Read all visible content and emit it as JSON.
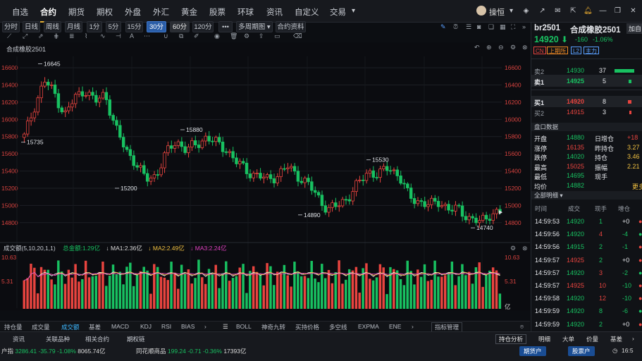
{
  "topnav": {
    "tabs": [
      "自选",
      "合约",
      "期货",
      "期权",
      "外盘",
      "外汇",
      "黄金",
      "股票",
      "环球",
      "资讯",
      "自定义",
      "交易"
    ],
    "active": "合约",
    "username": "操恒"
  },
  "toolbar": {
    "periods": [
      "分时",
      "日线",
      "周线",
      "月线",
      "1分",
      "5分",
      "15分",
      "30分",
      "60分",
      "120分"
    ],
    "active_period": "30分",
    "more": "•••",
    "multi_period": "多周期图",
    "contract_info": "合约资料"
  },
  "chart": {
    "title": "合成橡胶2501",
    "y_ticks": [
      "16600",
      "16400",
      "16200",
      "16000",
      "15800",
      "15600",
      "15400",
      "15200",
      "15000",
      "14800"
    ],
    "x_ticks": [
      "2024/09",
      "10/09",
      "10/11",
      "10/15",
      "10/17",
      "10/21",
      "10/23",
      "10/25",
      "10/29"
    ],
    "annotations": {
      "a1": "16645",
      "a2": "15735",
      "a3": "15880",
      "a4": "15200",
      "a5": "15530",
      "a6": "14890",
      "a7": "14740"
    }
  },
  "volume": {
    "title": "成交额(5,10,20,1,1)",
    "total": "总金额:1.29亿",
    "ma1": "MA1:2.36亿",
    "ma2": "MA2:2.49亿",
    "ma3": "MA3:2.24亿",
    "y_top": "10.63",
    "y_mid": "5.31",
    "unit": "亿"
  },
  "chart_data": {
    "type": "candlestick",
    "title": "合成橡胶2501",
    "period": "30分",
    "ylim": [
      14700,
      16650
    ],
    "x_labels": [
      "2024/09",
      "10/09",
      "10/11",
      "10/15",
      "10/17",
      "10/21",
      "10/23",
      "10/25",
      "10/29"
    ],
    "marked_extremes": [
      {
        "label": "high",
        "value": 16645
      },
      {
        "label": "low",
        "value": 15735
      },
      {
        "label": "high",
        "value": 15880
      },
      {
        "label": "low",
        "value": 15200
      },
      {
        "label": "high",
        "value": 15530
      },
      {
        "label": "low",
        "value": 14890
      },
      {
        "label": "low",
        "value": 14740
      }
    ],
    "close_path": [
      15800,
      16150,
      16450,
      16300,
      16050,
      16250,
      16350,
      16200,
      16300,
      15900,
      15650,
      15500,
      15300,
      15350,
      15600,
      15750,
      15650,
      15700,
      15800,
      15720,
      15650,
      15500,
      15400,
      15350,
      15300,
      15350,
      15450,
      15350,
      15250,
      15100,
      14950,
      15000,
      15100,
      15250,
      15400,
      15350,
      15450,
      15350,
      15100,
      15050,
      15000,
      15050,
      14950,
      14950,
      14850,
      14800,
      14900,
      14920
    ],
    "volume_ylim": [
      0,
      10.63
    ],
    "volume_unit": "亿"
  },
  "indicator_tabs_left": [
    "持仓量",
    "成交量",
    "成交额",
    "基差",
    "MACD",
    "KDJ",
    "RSI",
    "BIAS"
  ],
  "indicator_tabs_left_active": "成交额",
  "indicator_tabs_right": [
    "BOLL",
    "神奇九转",
    "买持价格",
    "多空线",
    "EXPMA",
    "ENE"
  ],
  "indicator_manage": "指标管理",
  "bottom_links": [
    "资讯",
    "关联品种",
    "相关合约",
    "期权链"
  ],
  "index_bar": {
    "i1_name": "户指",
    "i1_val": "3286.41",
    "i1_chg": "-35.79",
    "i1_pct": "-1.08%",
    "i1_amt": "8065.74亿",
    "i2_name": "同花顺商品",
    "i2_val": "199.24",
    "i2_chg": "-0.71",
    "i2_pct": "-0.36%",
    "i2_amt": "17393亿"
  },
  "holding_analysis": "持仓分析",
  "right": {
    "code": "br2501",
    "name": "合成橡胶2501",
    "add": "加自",
    "price": "14920",
    "change": "-160",
    "pct": "-1.06%",
    "tags": [
      "CN",
      "上期所",
      "L2",
      "主力"
    ],
    "ask2_label": "卖2",
    "ask2_price": "14930",
    "ask2_vol": "37",
    "ask1_label": "卖1",
    "ask1_price": "14925",
    "ask1_vol": "5",
    "bid1_label": "买1",
    "bid1_price": "14920",
    "bid1_vol": "8",
    "bid2_label": "买2",
    "bid2_price": "14915",
    "bid2_vol": "3",
    "section_title": "盘口数据",
    "stats": [
      {
        "l": "开盘",
        "v": "14880",
        "l2": "日增仓",
        "v2": "+18"
      },
      {
        "l": "涨停",
        "v": "16135",
        "l2": "昨持仓",
        "v2": "3.27"
      },
      {
        "l": "跌停",
        "v": "14020",
        "l2": "持仓",
        "v2": "3.46"
      },
      {
        "l": "最高",
        "v": "15025",
        "l2": "振幅",
        "v2": "2.21"
      },
      {
        "l": "最低",
        "v": "14695",
        "l2": "现手",
        "v2": ""
      },
      {
        "l": "均价",
        "v": "14882",
        "l2": "",
        "v2": "更多"
      }
    ],
    "ticks_title": "全部明细",
    "tick_headers": [
      "时间",
      "成交",
      "现手",
      "增仓"
    ],
    "ticks": [
      {
        "t": "14:59:53",
        "p": "14920",
        "v": "1",
        "d": "+0"
      },
      {
        "t": "14:59:56",
        "p": "14920",
        "v": "4",
        "d": "-4"
      },
      {
        "t": "14:59:56",
        "p": "14915",
        "v": "2",
        "d": "-1"
      },
      {
        "t": "14:59:57",
        "p": "14925",
        "v": "2",
        "d": "+0"
      },
      {
        "t": "14:59:57",
        "p": "14920",
        "v": "3",
        "d": "-2"
      },
      {
        "t": "14:59:57",
        "p": "14925",
        "v": "10",
        "d": "-10"
      },
      {
        "t": "14:59:58",
        "p": "14920",
        "v": "12",
        "d": "-10"
      },
      {
        "t": "14:59:59",
        "p": "14920",
        "v": "8",
        "d": "-6"
      },
      {
        "t": "14:59:59",
        "p": "14920",
        "v": "2",
        "d": "+0"
      }
    ],
    "bottom_tabs": [
      "明细",
      "大单",
      "价量",
      "基差"
    ]
  },
  "status_right": {
    "b1": "期货户",
    "b2": "股票户",
    "clock": "16:5"
  }
}
